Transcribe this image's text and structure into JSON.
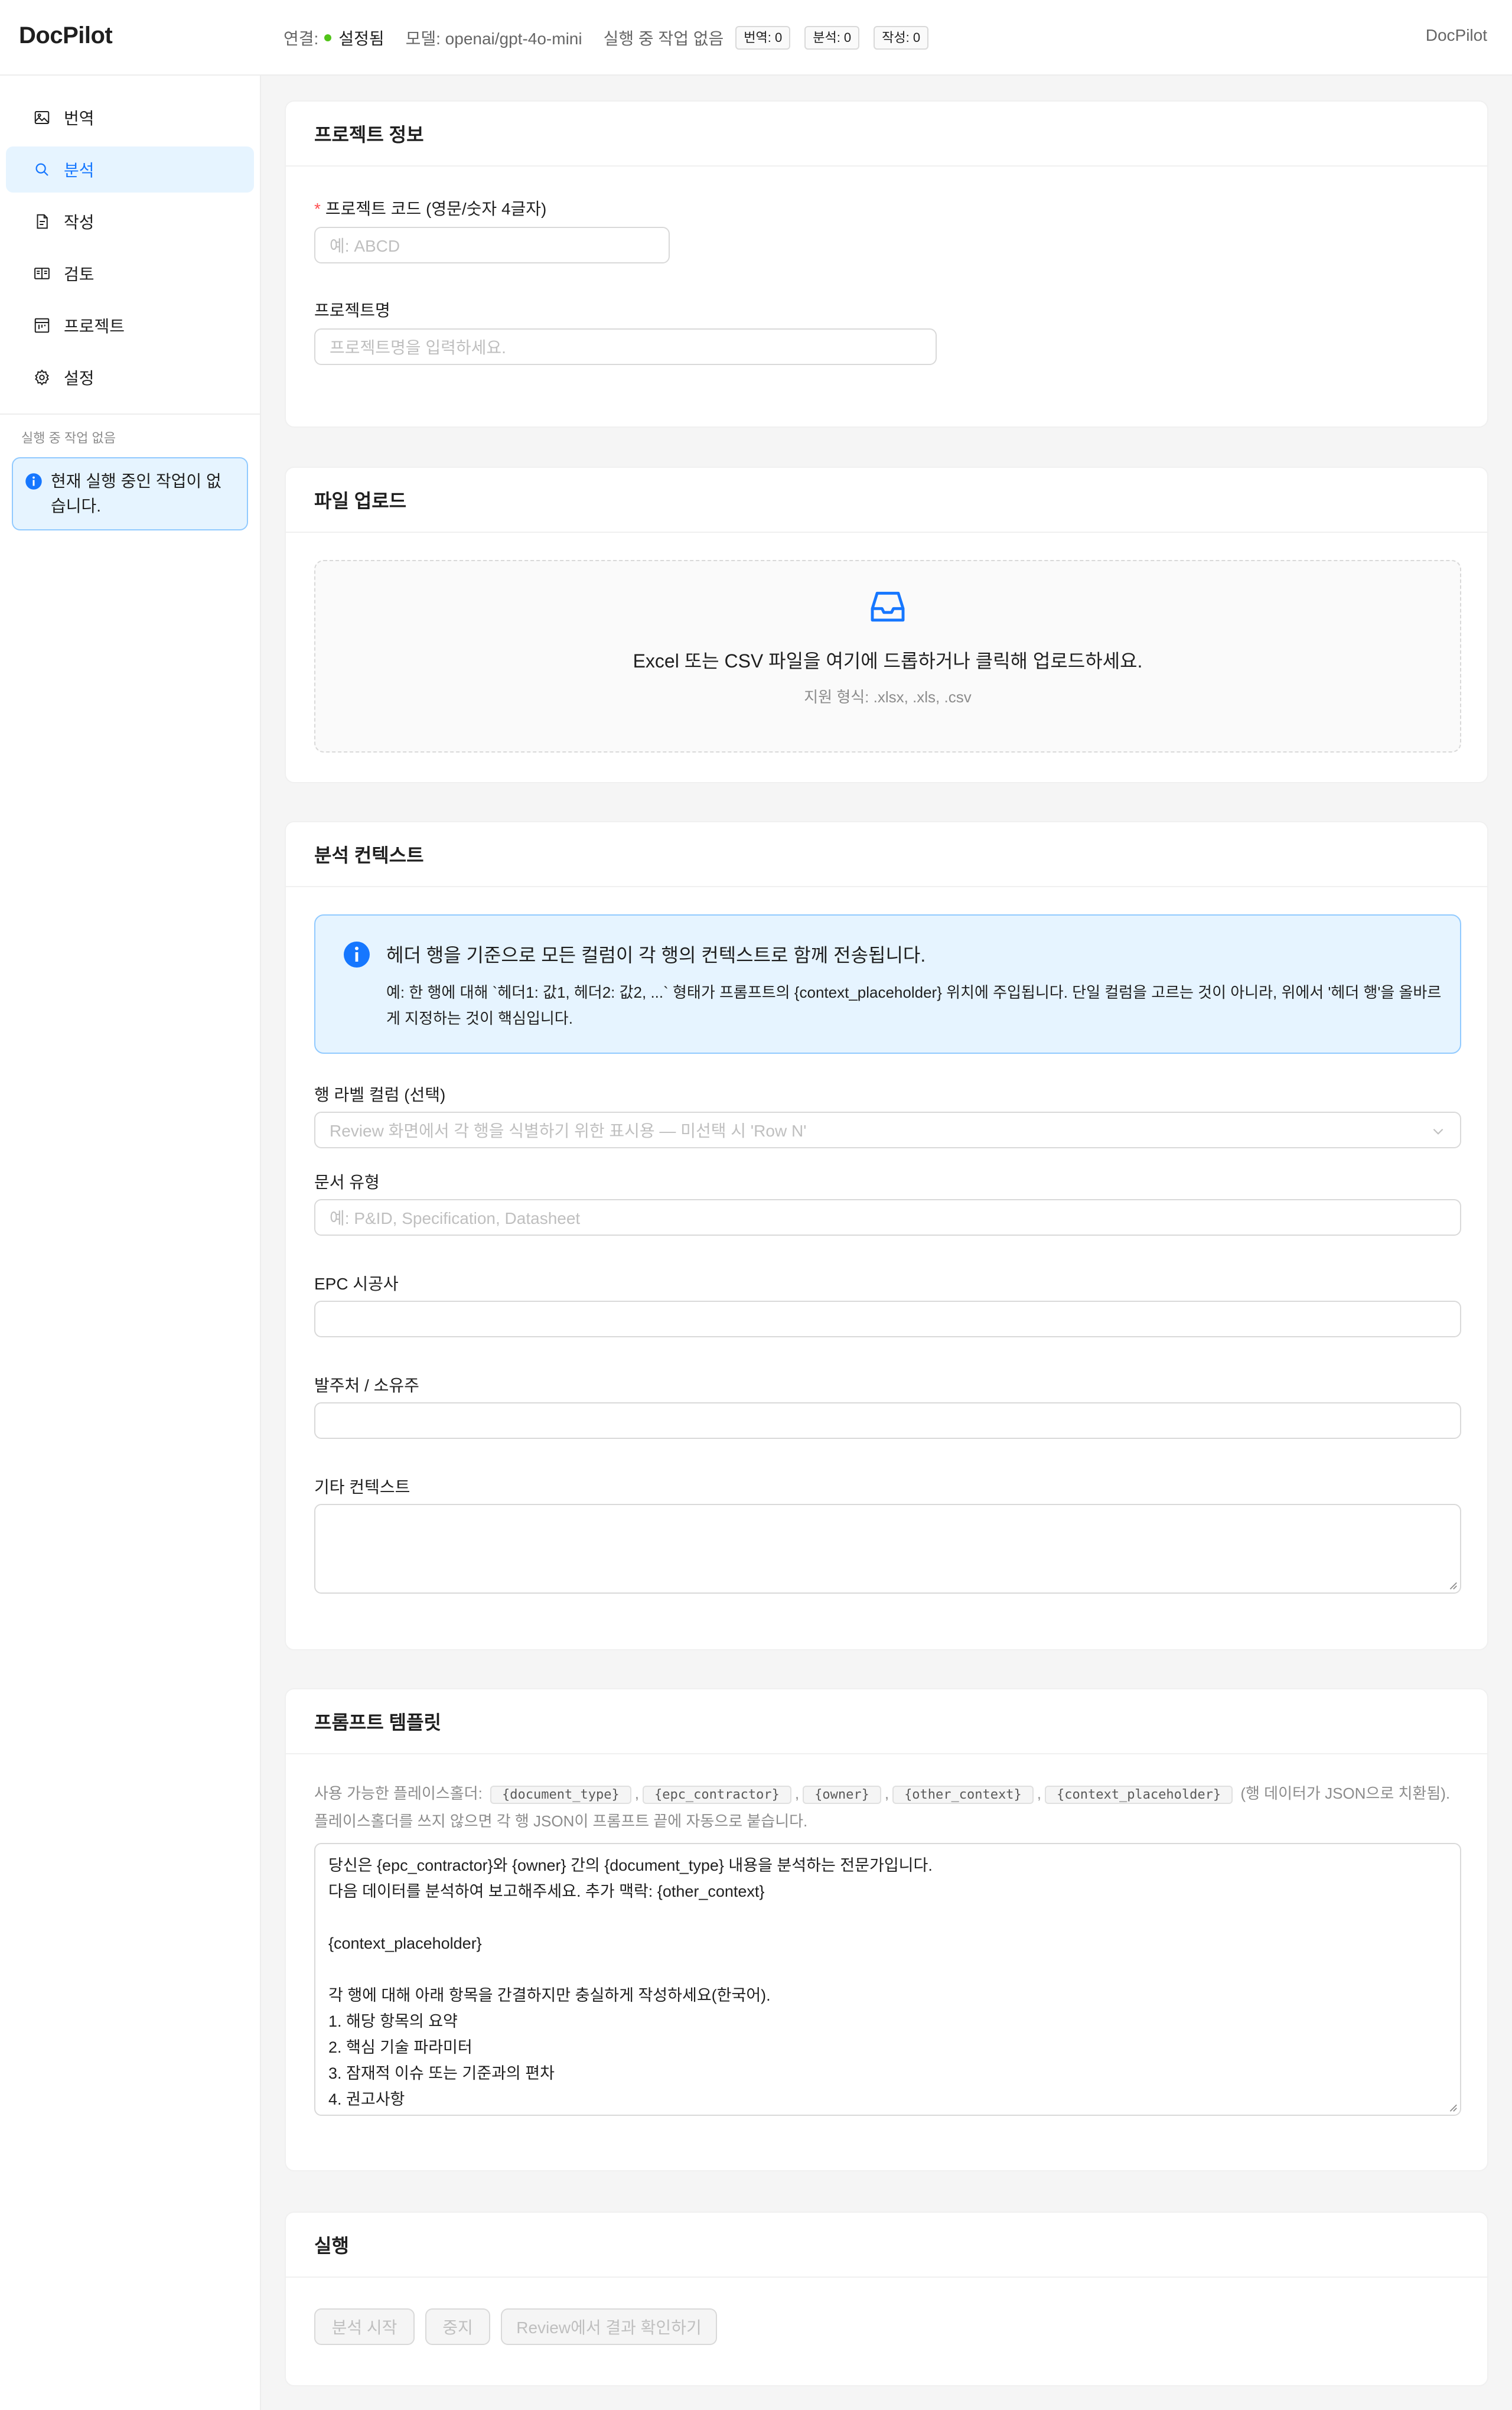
{
  "header": {
    "brand": "DocPilot",
    "connection_label": "연결:",
    "connection_status": "설정됨",
    "model_text": "모델: openai/gpt-4o-mini",
    "running_text": "실행 중 작업 없음",
    "counters": [
      "번역: 0",
      "분석: 0",
      "작성: 0"
    ],
    "right_title": "DocPilot"
  },
  "sidebar": {
    "items": [
      {
        "label": "번역",
        "icon": "translate-icon"
      },
      {
        "label": "분석",
        "icon": "search-icon"
      },
      {
        "label": "작성",
        "icon": "document-edit-icon"
      },
      {
        "label": "검토",
        "icon": "book-open-icon"
      },
      {
        "label": "프로젝트",
        "icon": "project-icon"
      },
      {
        "label": "설정",
        "icon": "gear-icon"
      }
    ],
    "active_index": 1,
    "caption": "실행 중 작업 없음",
    "alert": "현재 실행 중인 작업이 없습니다."
  },
  "project_info": {
    "title": "프로젝트 정보",
    "code_label": "프로젝트 코드 (영문/숫자 4글자)",
    "code_required_mark": "*",
    "code_placeholder": "예: ABCD",
    "name_label": "프로젝트명",
    "name_placeholder": "프로젝트명을 입력하세요."
  },
  "upload": {
    "title": "파일 업로드",
    "main_text": "Excel 또는 CSV 파일을 여기에 드롭하거나 클릭해 업로드하세요.",
    "sub_text": "지원 형식: .xlsx, .xls, .csv"
  },
  "context": {
    "title": "분석 컨텍스트",
    "info_title": "헤더 행을 기준으로 모든 컬럼이 각 행의 컨텍스트로 함께 전송됩니다.",
    "info_desc": "예: 한 행에 대해 `헤더1: 값1, 헤더2: 값2, ...` 형태가 프롬프트의 {context_placeholder} 위치에 주입됩니다. 단일 컬럼을 고르는 것이 아니라, 위에서 '헤더 행'을 올바르게 지정하는 것이 핵심입니다.",
    "row_label_label": "행 라벨 컬럼 (선택)",
    "row_label_placeholder": "Review 화면에서 각 행을 식별하기 위한 표시용 — 미선택 시 'Row N'",
    "doc_type_label": "문서 유형",
    "doc_type_placeholder": "예: P&ID, Specification, Datasheet",
    "epc_label": "EPC 시공사",
    "owner_label": "발주처 / 소유주",
    "other_label": "기타 컨텍스트"
  },
  "prompt": {
    "title": "프롬프트 템플릿",
    "hint_prefix": "사용 가능한 플레이스홀더:",
    "placeholders": [
      "{document_type}",
      "{epc_contractor}",
      "{owner}",
      "{other_context}",
      "{context_placeholder}"
    ],
    "hint_suffix": "(행 데이터가 JSON으로 치환됨). 플레이스홀더를 쓰지 않으면 각 행 JSON이 프롬프트 끝에 자동으로 붙습니다.",
    "template": "당신은 {epc_contractor}와 {owner} 간의 {document_type} 내용을 분석하는 전문가입니다.\n다음 데이터를 분석하여 보고해주세요. 추가 맥락: {other_context}\n\n{context_placeholder}\n\n각 행에 대해 아래 항목을 간결하지만 충실하게 작성하세요(한국어).\n1. 해당 항목의 요약\n2. 핵심 기술 파라미터\n3. 잠재적 이슈 또는 기준과의 편차\n4. 권고사항"
  },
  "run": {
    "title": "실행",
    "start_label": "분석 시작",
    "stop_label": "중지",
    "review_label": "Review에서 결과 확인하기"
  },
  "colors": {
    "accent": "#1677ff",
    "active_bg": "#e6f4ff",
    "info_border": "#91caff",
    "connected": "#52c41a",
    "required": "#ff4d4f"
  }
}
